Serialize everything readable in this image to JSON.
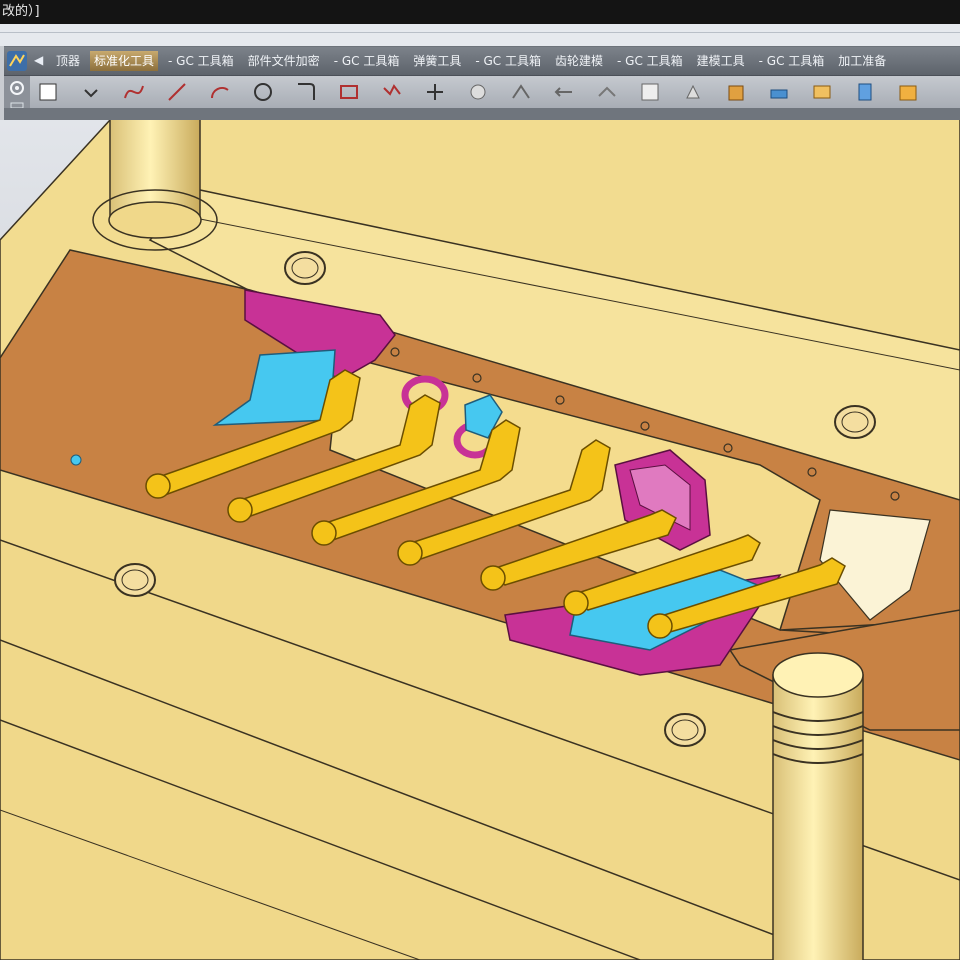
{
  "app": {
    "title_fragment": "改的）]"
  },
  "ribbon": {
    "tabs": [
      {
        "label": "顶器",
        "selected": false
      },
      {
        "label": "标准化工具",
        "selected": true
      },
      {
        "label": "- GC 工具箱",
        "selected": false
      },
      {
        "label": "部件文件加密",
        "selected": false
      },
      {
        "label": "- GC 工具箱",
        "selected": false
      },
      {
        "label": "弹簧工具",
        "selected": false
      },
      {
        "label": "- GC 工具箱",
        "selected": false
      },
      {
        "label": "齿轮建模",
        "selected": false
      },
      {
        "label": "- GC 工具箱",
        "selected": false
      },
      {
        "label": "建模工具",
        "selected": false
      },
      {
        "label": "- GC 工具箱",
        "selected": false
      },
      {
        "label": "加工准备",
        "selected": false
      }
    ],
    "tool_icons": [
      "sketch-icon",
      "rectangle-dropdown-icon",
      "spline-icon",
      "line-icon",
      "arc-icon",
      "circle-icon",
      "fillet-icon",
      "rect-icon",
      "profile-icon",
      "point-icon",
      "offset-curve-icon",
      "trim-icon",
      "mirror-icon",
      "section-icon",
      "datum-plane-icon",
      "constraint-icon",
      "extrude-icon",
      "revolve-icon",
      "boolean-icon",
      "shell-icon",
      "solid-icon"
    ]
  },
  "viewport": {
    "label": "mold-3d-view"
  },
  "colors": {
    "mold_plate": "#f0d88a",
    "mold_edge": "#3a3222",
    "strip": "#c88244",
    "pin": "#f4c319",
    "insert_magenta": "#c83296",
    "insert_cyan": "#46c8f0",
    "background_top": "#dfe2e8",
    "background_bottom": "#b8bcc3"
  }
}
